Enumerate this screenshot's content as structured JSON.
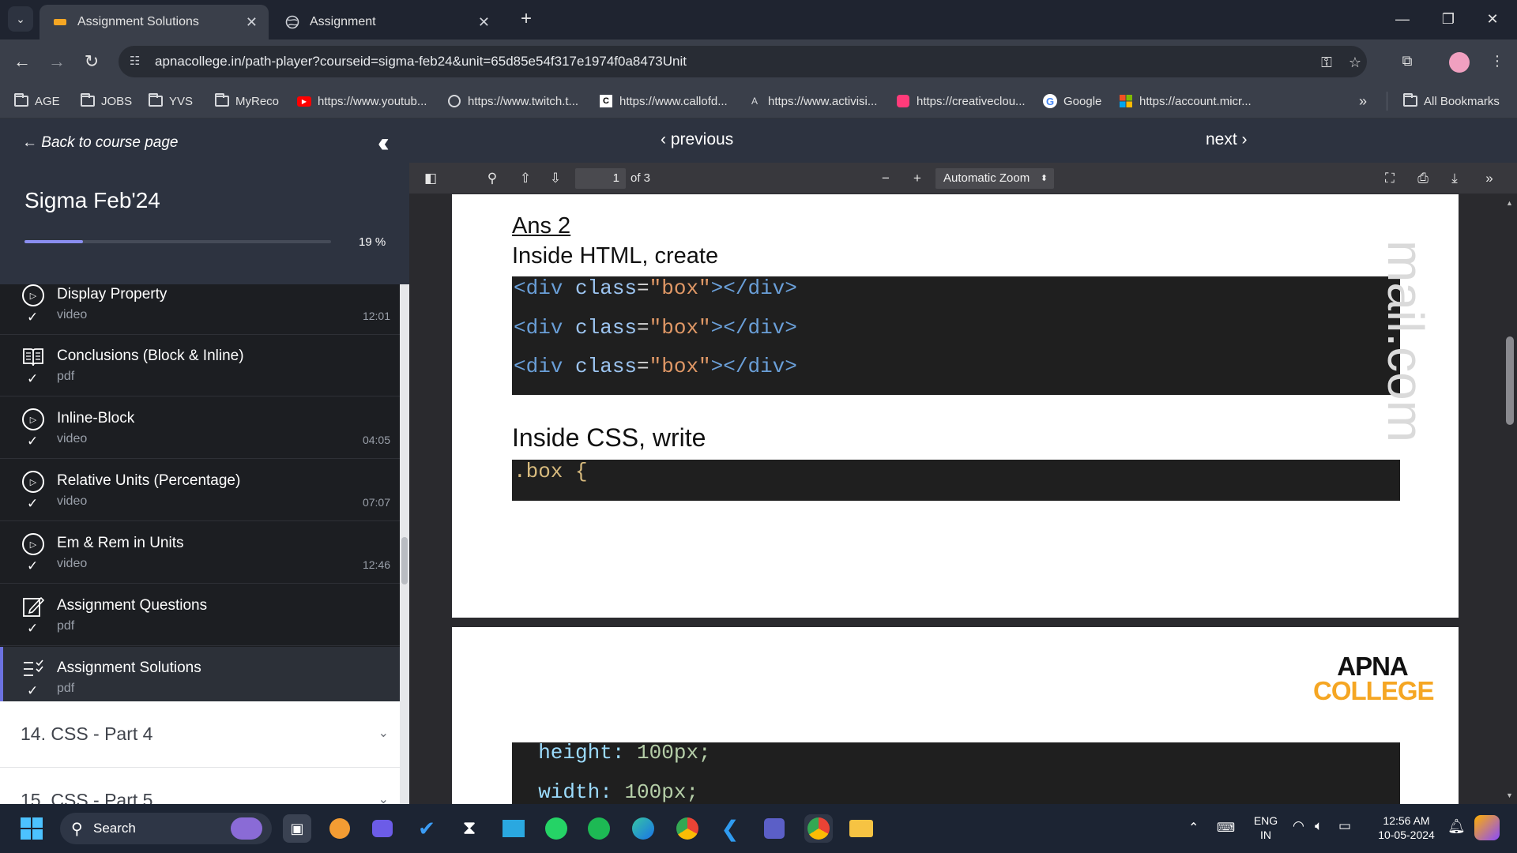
{
  "tabs": [
    {
      "title": "Assignment Solutions",
      "active": true
    },
    {
      "title": "Assignment",
      "active": false
    }
  ],
  "address_bar": {
    "url": "apnacollege.in/path-player?courseid=sigma-feb24&unit=65d85e54f317e1974f0a8473Unit"
  },
  "bookmarks": [
    {
      "label": "AGE",
      "icon": "folder-icon"
    },
    {
      "label": "JOBS",
      "icon": "folder-icon"
    },
    {
      "label": "YVS",
      "icon": "folder-icon"
    },
    {
      "label": "MyReco",
      "icon": "folder-icon"
    },
    {
      "label": "https://www.youtub...",
      "icon": "youtube-icon"
    },
    {
      "label": "https://www.twitch.t...",
      "icon": "globe-icon"
    },
    {
      "label": "https://www.callofd...",
      "icon": "cod-icon"
    },
    {
      "label": "https://www.activisi...",
      "icon": "activision-icon"
    },
    {
      "label": "https://creativeclou...",
      "icon": "creative-cloud-icon"
    },
    {
      "label": "Google",
      "icon": "google-icon"
    },
    {
      "label": "https://account.micr...",
      "icon": "microsoft-icon"
    }
  ],
  "all_bookmarks": "All Bookmarks",
  "sidebar": {
    "back_label": "Back to course page",
    "course_title": "Sigma Feb'24",
    "progress_percent": 19,
    "progress_text": "19 %",
    "lessons": [
      {
        "title": "Display Property",
        "type": "video",
        "duration": "12:01",
        "icon": "play-icon"
      },
      {
        "title": "Conclusions (Block & Inline)",
        "type": "pdf",
        "duration": "",
        "icon": "book-icon"
      },
      {
        "title": "Inline-Block",
        "type": "video",
        "duration": "04:05",
        "icon": "play-icon"
      },
      {
        "title": "Relative Units (Percentage)",
        "type": "video",
        "duration": "07:07",
        "icon": "play-icon"
      },
      {
        "title": "Em & Rem in Units",
        "type": "video",
        "duration": "12:46",
        "icon": "play-icon"
      },
      {
        "title": "Assignment Questions",
        "type": "pdf",
        "duration": "",
        "icon": "edit-icon"
      },
      {
        "title": "Assignment Solutions",
        "type": "pdf",
        "duration": "",
        "icon": "checklist-icon",
        "active": true
      }
    ],
    "sections": [
      {
        "title": "14. CSS - Part 4"
      },
      {
        "title": "15. CSS - Part 5"
      }
    ]
  },
  "nav": {
    "previous": "previous",
    "next": "next"
  },
  "pdf_toolbar": {
    "page": "1",
    "of_pages": "of 3",
    "zoom": "Automatic Zoom"
  },
  "document": {
    "ans_heading": "Ans 2",
    "html_intro": "Inside HTML, create",
    "html_lines": [
      "<div class=\"box\"></div>",
      "<div class=\"box\"></div>",
      "<div class=\"box\"></div>"
    ],
    "css_intro": "Inside CSS, write",
    "css_line": ".box {",
    "css_lines_page2": [
      "  height: 100px;",
      "  width: 100px;"
    ],
    "watermark": "mail.com",
    "logo_line1": "APNA",
    "logo_line2": "COLLEGE"
  },
  "taskbar": {
    "search_label": "Search",
    "lang_line1": "ENG",
    "lang_line2": "IN",
    "time": "12:56 AM",
    "date": "10-05-2024"
  },
  "colors": {
    "accent": "#6c72e0",
    "sidebar_dark": "#1c1e22",
    "logo_orange": "#f5a623"
  }
}
